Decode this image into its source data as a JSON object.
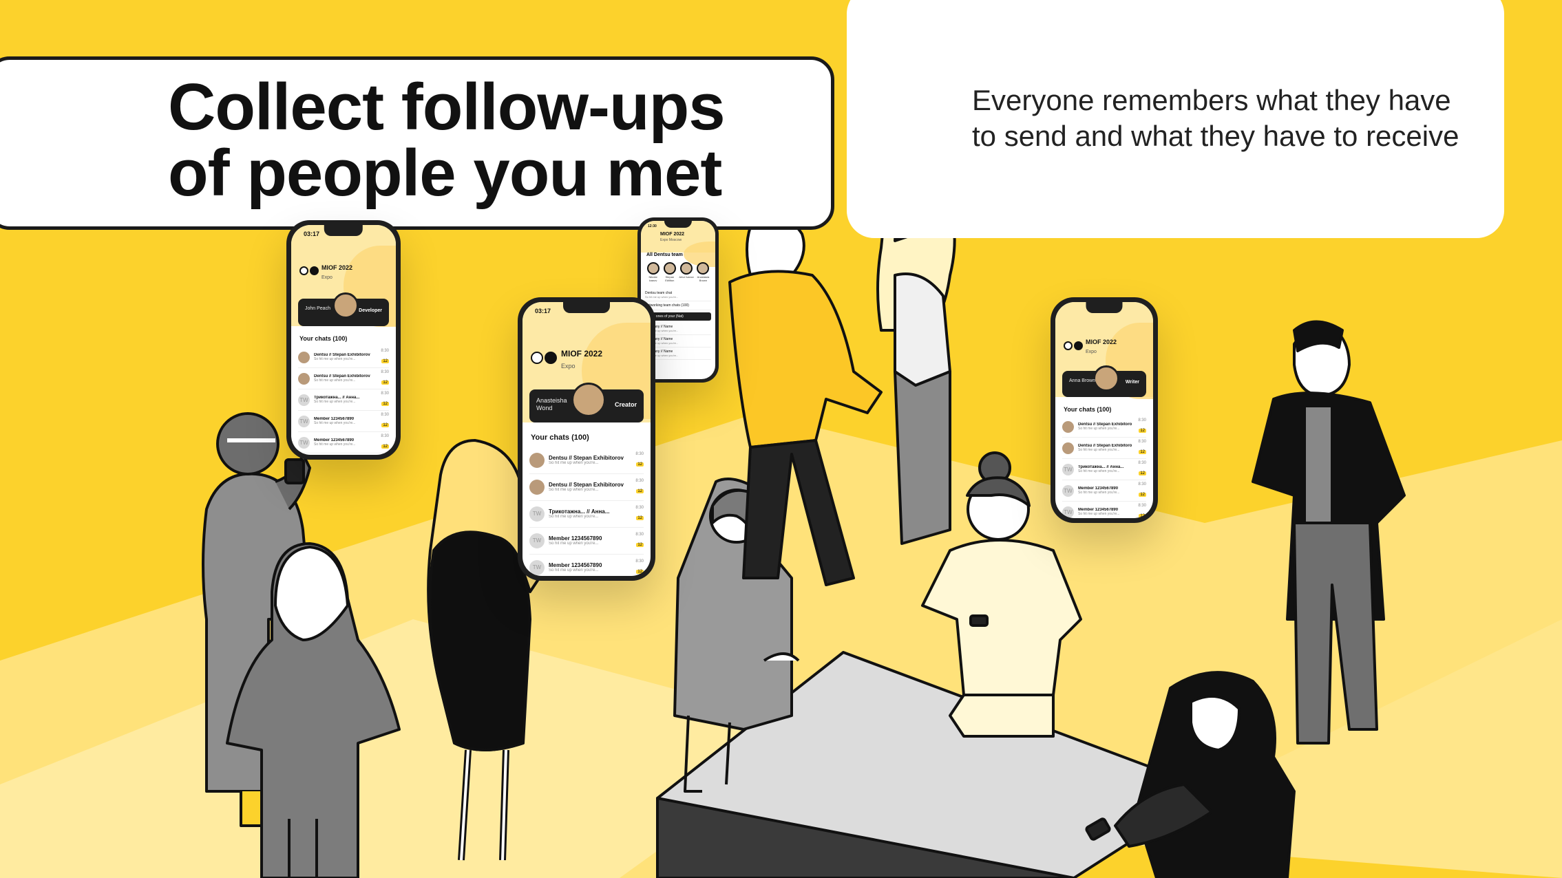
{
  "headline": {
    "line1": "Collect follow-ups",
    "line2": "of people you met"
  },
  "subtext": "Everyone remembers what they have to send and what they have to receive",
  "colors": {
    "background": "#FCD22C",
    "floor_light": "#FFE680",
    "ink": "#111111",
    "table": "#DCDCDC"
  },
  "phones": {
    "main": {
      "time": "03:17",
      "event": "MIOF 2022",
      "event_sub": "Expo",
      "profile_name": "Anasteisha Wond",
      "profile_role": "Creator",
      "section": "Your chats (100)",
      "chats": [
        {
          "title": "Dentsu // Stepan Exhibitorov",
          "preview": "So hit me up when you're...",
          "time": "8:30",
          "badge": "12"
        },
        {
          "title": "Dentsu // Stepan Exhibitorov",
          "preview": "So hit me up when you're...",
          "time": "8:30",
          "badge": "12"
        },
        {
          "title": "Трикотажна... // Анна...",
          "preview": "So hit me up when you're...",
          "time": "8:30",
          "badge": "12",
          "initials": "TW"
        },
        {
          "title": "Member 1234567890",
          "preview": "So hit me up when you're...",
          "time": "8:30",
          "badge": "12",
          "initials": "TW"
        },
        {
          "title": "Member 1234567890",
          "preview": "So hit me up when you're...",
          "time": "8:30",
          "badge": "12",
          "initials": "TW"
        },
        {
          "title": "Member 1234567890",
          "preview": "",
          "time": "",
          "badge": ""
        }
      ]
    },
    "left": {
      "time": "03:17",
      "event": "MIOF 2022",
      "event_sub": "Expo",
      "profile_name": "John Peach",
      "profile_role": "Developer",
      "section": "Your chats (100)",
      "chats": [
        {
          "title": "Dentsu // Stepan Exhibitorov",
          "preview": "So hit me up when you're...",
          "time": "8:30",
          "badge": "12"
        },
        {
          "title": "Dentsu // Stepan Exhibitorov",
          "preview": "So hit me up when you're...",
          "time": "8:30",
          "badge": "12"
        },
        {
          "title": "Трикотажна... // Анна...",
          "preview": "So hit me up when you're...",
          "time": "8:30",
          "badge": "12",
          "initials": "TW"
        },
        {
          "title": "Member 1234567890",
          "preview": "So hit me up when you're...",
          "time": "8:30",
          "badge": "12",
          "initials": "TW"
        },
        {
          "title": "Member 1234567890",
          "preview": "So hit me up when you're...",
          "time": "8:30",
          "badge": "12",
          "initials": "TW"
        }
      ]
    },
    "right": {
      "event": "MIOF 2022",
      "event_sub": "Expo",
      "profile_name": "Anna Brown",
      "profile_role": "Writer",
      "section": "Your chats (100)",
      "chats": [
        {
          "title": "Dentsu // Stepan Exhibitorov",
          "preview": "So hit me up when you're...",
          "time": "8:30",
          "badge": "12"
        },
        {
          "title": "Dentsu // Stepan Exhibitorov",
          "preview": "So hit me up when you're...",
          "time": "8:30",
          "badge": "12"
        },
        {
          "title": "Трикотажна... // Анна...",
          "preview": "So hit me up when you're...",
          "time": "8:30",
          "badge": "12",
          "initials": "TW"
        },
        {
          "title": "Member 1234567890",
          "preview": "So hit me up when you're...",
          "time": "8:30",
          "badge": "12",
          "initials": "TW"
        },
        {
          "title": "Member 1234567890",
          "preview": "So hit me up when you're...",
          "time": "8:30",
          "badge": "12",
          "initials": "TW"
        }
      ]
    },
    "top": {
      "time": "12:30",
      "event": "MIOF 2022",
      "event_sub": "Expo Moscow",
      "team_title": "All Dentsu team",
      "team": [
        "Nikolai Ivanov",
        "Stepan Ekfilton",
        "Artur Ivanov",
        "Anastasia Brown"
      ],
      "rows": [
        {
          "title": "Dentsu team chat",
          "sub": "So hit me up when you're..."
        },
        {
          "title": "Networking team chats (100)",
          "sub": ""
        },
        {
          "title": "Company // Name",
          "sub": "So hit me up when you're..."
        },
        {
          "title": "Company // Name",
          "sub": "So hit me up when you're..."
        },
        {
          "title": "Company // Name",
          "sub": "So hit me up when you're..."
        }
      ],
      "search": "Save ones of your (Nat)"
    }
  }
}
